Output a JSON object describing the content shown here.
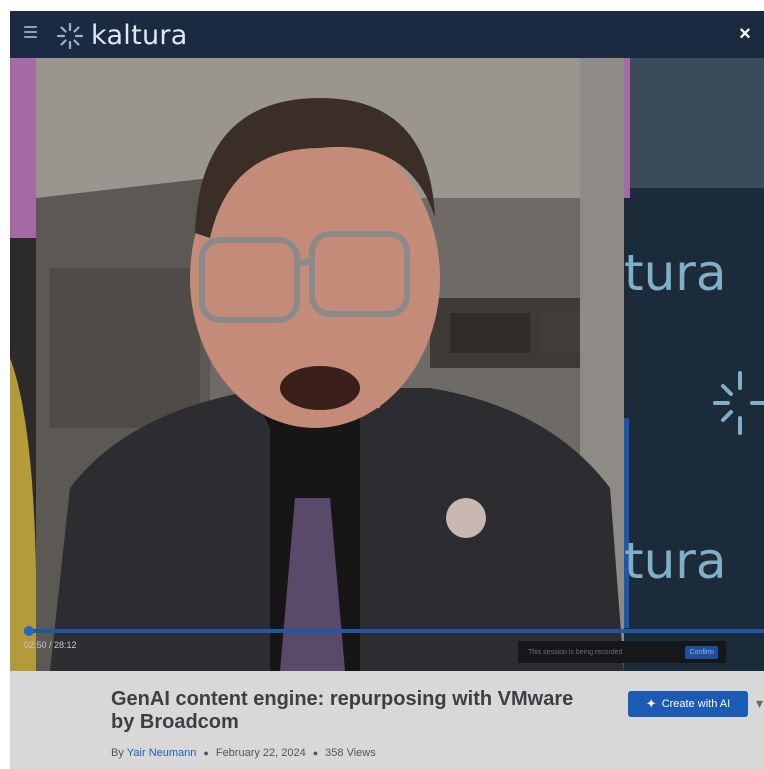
{
  "header": {
    "brand": "kaltura",
    "icons": [
      "menu-icon",
      "kaltura-logo-icon",
      "close-icon"
    ],
    "close_label": "×"
  },
  "player": {
    "timecode": "02:50 / 28:12",
    "progress_fraction": 0.1,
    "recording_notice": "This session is being recorded",
    "confirm_label": "Confirm",
    "backdrop_text_top": "tura",
    "backdrop_text_bottom": "tura"
  },
  "entry": {
    "title": "GenAI content engine: repurposing with VMware by Broadcom",
    "by_prefix": "By",
    "author": "Yair Neumann",
    "date": "February 22, 2024",
    "views": "358 Views",
    "create_label": "Create with AI"
  },
  "colors": {
    "header_bg": "#1b2a41",
    "accent": "#1c5bb5",
    "info_bg": "#d8d8d8"
  }
}
